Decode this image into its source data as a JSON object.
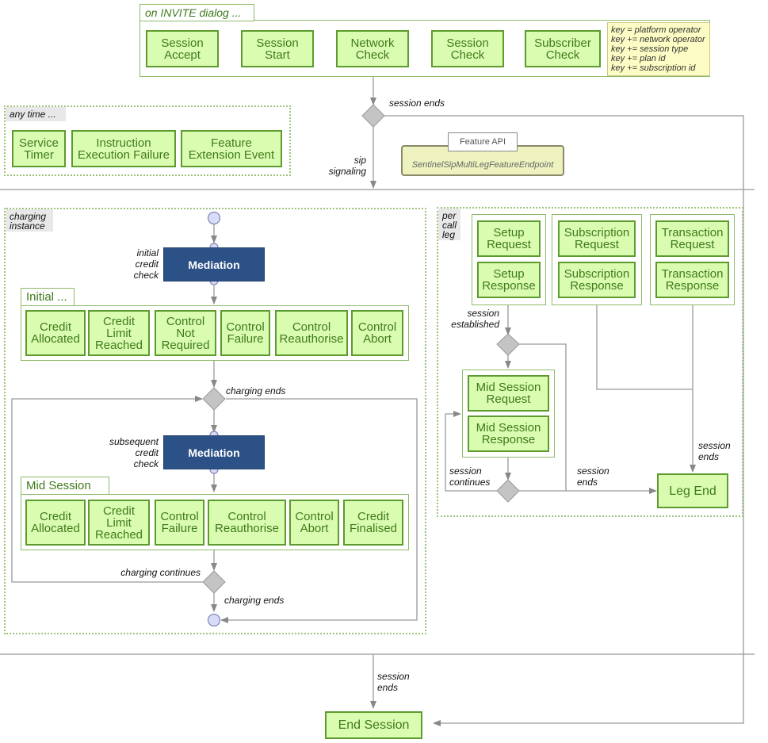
{
  "invite_group": {
    "label": "on INVITE dialog ...",
    "steps": [
      "Session\nAccept",
      "Session\nStart",
      "Network\nCheck",
      "Session\nCheck",
      "Subscriber\nCheck"
    ],
    "key_lines": "key = platform operator\nkey += network operator\nkey += session type\nkey += plan id\nkey += subscription id"
  },
  "any_time_group": {
    "label": "any time ...",
    "items": [
      "Service\nTimer",
      "Instruction\nExecution Failure",
      "Feature\nExtension Event"
    ]
  },
  "feature_api": {
    "tab": "Feature API",
    "endpoint": "SentinelSipMultiLegFeatureEndpoint"
  },
  "flow_labels": {
    "session_ends_top": "session ends",
    "sip_signaling": "sip\nsignaling",
    "session_ends_bottom": "session\nends"
  },
  "charging": {
    "tag": "charging\ninstance",
    "initial_check_label": "initial\ncredit\ncheck",
    "mediation": "Mediation",
    "initial_group": {
      "label": "Initial ...",
      "items": [
        "Credit\nAllocated",
        "Credit\nLimit\nReached",
        "Control\nNot\nRequired",
        "Control\nFailure",
        "Control\nReauthorise",
        "Control\nAbort"
      ]
    },
    "charging_ends_1": "charging ends",
    "subsequent_check_label": "subsequent\ncredit\ncheck",
    "mid_group": {
      "label": "Mid Session ...",
      "items": [
        "Credit\nAllocated",
        "Credit\nLimit\nReached",
        "Control\nFailure",
        "Control\nReauthorise",
        "Control\nAbort",
        "Credit\nFinalised"
      ]
    },
    "charging_continues": "charging continues",
    "charging_ends_2": "charging ends"
  },
  "call_leg": {
    "tag": "per\ncall\nleg",
    "setup": [
      "Setup\nRequest",
      "Setup\nResponse"
    ],
    "subscription": [
      "Subscription\nRequest",
      "Subscription\nResponse"
    ],
    "transaction": [
      "Transaction\nRequest",
      "Transaction\nResponse"
    ],
    "session_established": "session\nestablished",
    "mid_session": [
      "Mid Session\nRequest",
      "Mid Session\nResponse"
    ],
    "session_continues": "session\ncontinues",
    "session_ends_a": "session\nends",
    "session_ends_b": "session\nends",
    "leg_end": "Leg End"
  },
  "end_session": "End Session"
}
